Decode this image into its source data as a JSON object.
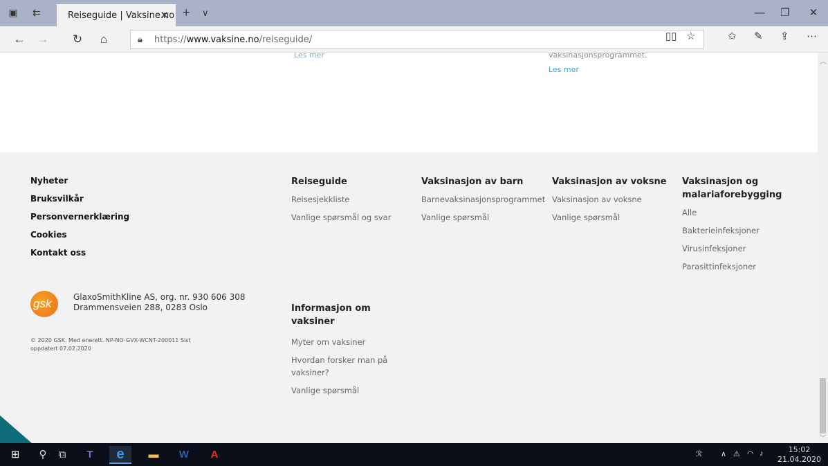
{
  "browser": {
    "tab_title": "Reiseguide | Vaksine.no",
    "url_prefix": "https://",
    "url_domain": "www.vaksine.no",
    "url_path": "/reiseguide/"
  },
  "teasers": {
    "left_les_mer": "Les mer",
    "right_text": "vaksinasjonsprogrammet.",
    "right_les_mer": "Les mer"
  },
  "footer": {
    "main_links": [
      "Nyheter",
      "Bruksvilkår",
      "Personvernerklæring",
      "Cookies",
      "Kontakt oss"
    ],
    "company_line1": "GlaxoSmithKline AS, org. nr. 930 606 308",
    "company_line2": "Drammensveien 288, 0283 Oslo",
    "logo_text": "gsk",
    "copyright": "© 2020 GSK. Med enerett. NP-NO-GVX-WCNT-200011 Sist oppdatert 07.02.2020",
    "reiseguide": {
      "title": "Reiseguide",
      "links": [
        "Reisesjekkliste",
        "Vanlige spørsmål og svar"
      ]
    },
    "barn": {
      "title": "Vaksinasjon av barn",
      "links": [
        "Barnevaksinasjonsprogrammet",
        "Vanlige spørsmål"
      ]
    },
    "voksne": {
      "title": "Vaksinasjon av voksne",
      "links": [
        "Vaksinasjon av voksne",
        "Vanlige spørsmål"
      ]
    },
    "malaria": {
      "title_line1": "Vaksinasjon og",
      "title_line2": "malariaforebygging",
      "links": [
        "Alle",
        "Bakterieinfeksjoner",
        "Virusinfeksjoner",
        "Parasittinfeksjoner"
      ]
    },
    "info": {
      "title_line1": "Informasjon om",
      "title_line2": "vaksiner",
      "links": [
        "Myter om vaksiner",
        "Hvordan forsker man på",
        "vaksiner?",
        "Vanlige spørsmål"
      ]
    }
  },
  "taskbar": {
    "time": "15:02",
    "date": "21.04.2020"
  }
}
